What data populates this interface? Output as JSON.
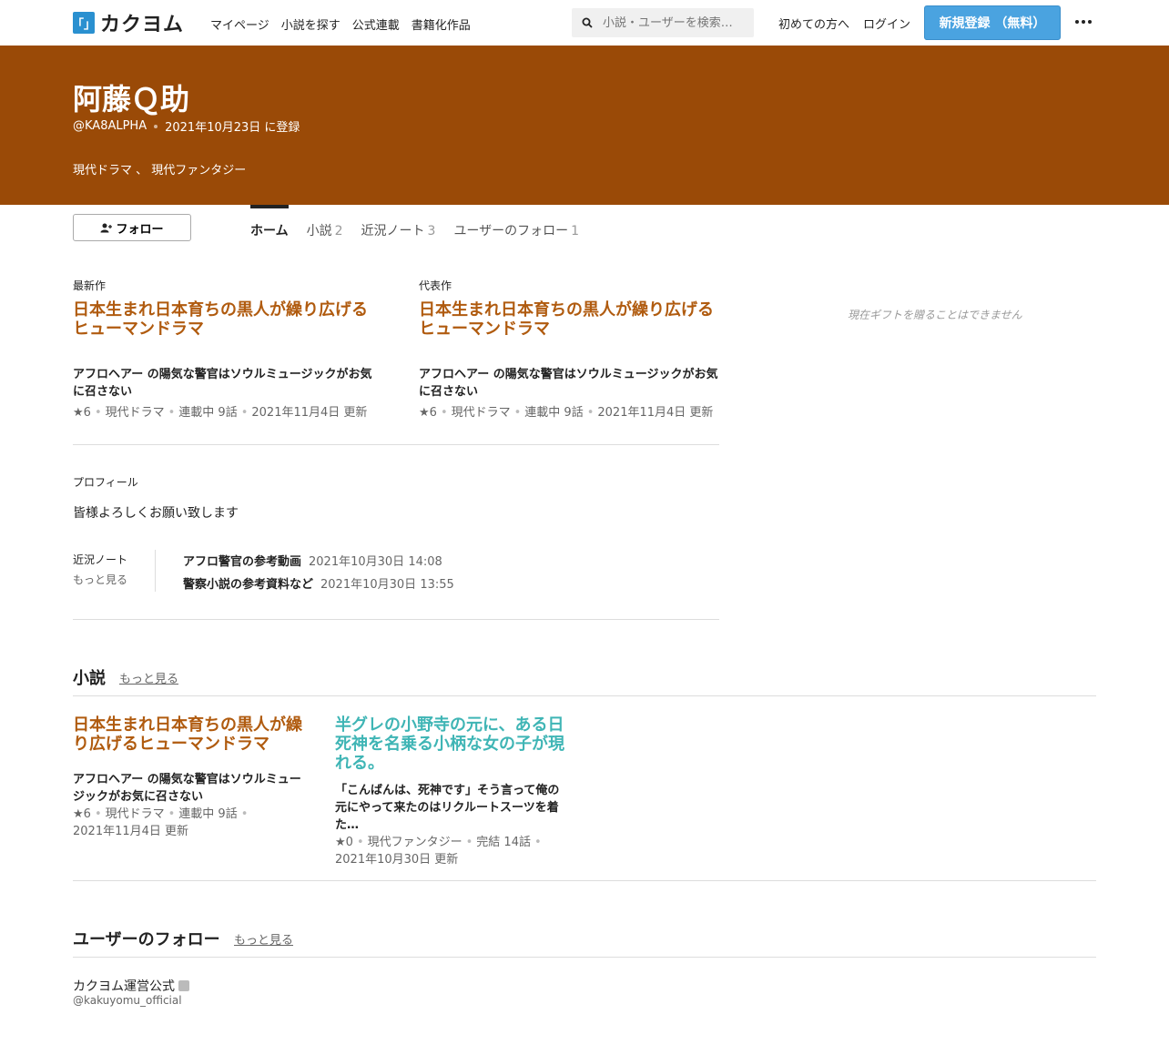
{
  "header": {
    "logo_mark": "「」",
    "logo_text": "カクヨム",
    "nav": [
      "マイページ",
      "小説を探す",
      "公式連載",
      "書籍化作品"
    ],
    "search_placeholder": "小説・ユーザーを検索…",
    "first_time": "初めての方へ",
    "login": "ログイン",
    "signup": "新規登録 （無料）"
  },
  "user": {
    "name": "阿藤Ｑ助",
    "handle": "@KA8ALPHA",
    "registered": "2021年10月23日 に登録",
    "genres": "現代ドラマ 、 現代ファンタジー"
  },
  "follow_label": "フォロー",
  "tabs": [
    {
      "label": "ホーム",
      "count": ""
    },
    {
      "label": "小説",
      "count": "2"
    },
    {
      "label": "近況ノート",
      "count": "3"
    },
    {
      "label": "ユーザーのフォロー",
      "count": "1"
    }
  ],
  "latest": {
    "label": "最新作",
    "title": "日本生まれ日本育ちの黒人が繰り広げるヒューマンドラマ",
    "catch": "アフロヘアー の陽気な警官はソウルミュージックがお気に召さない",
    "stars": "★6",
    "genre": "現代ドラマ",
    "status": "連載中 9話",
    "updated": "2021年11月4日 更新"
  },
  "featured": {
    "label": "代表作",
    "title": "日本生まれ日本育ちの黒人が繰り広げるヒューマンドラマ",
    "catch": "アフロヘアー の陽気な警官はソウルミュージックがお気に召さない",
    "stars": "★6",
    "genre": "現代ドラマ",
    "status": "連載中 9話",
    "updated": "2021年11月4日 更新"
  },
  "gift_text": "現在ギフトを贈ることはできません",
  "profile": {
    "label": "プロフィール",
    "text": "皆様よろしくお願い致します"
  },
  "notes": {
    "label": "近況ノート",
    "more": "もっと見る",
    "items": [
      {
        "title": "アフロ警官の参考動画",
        "date": "2021年10月30日 14:08"
      },
      {
        "title": "警察小説の参考資料など",
        "date": "2021年10月30日 13:55"
      }
    ]
  },
  "novels": {
    "title": "小説",
    "more": "もっと見る",
    "items": [
      {
        "title": "日本生まれ日本育ちの黒人が繰り広げるヒューマンドラマ",
        "catch": "アフロヘアー の陽気な警官はソウルミュージックがお気に召さない",
        "stars": "★6",
        "genre": "現代ドラマ",
        "status": "連載中 9話",
        "updated": "2021年11月4日 更新",
        "color": "#b05b0f"
      },
      {
        "title": "半グレの小野寺の元に、ある日死神を名乗る小柄な女の子が現れる。",
        "catch": "「こんばんは、死神です」そう言って俺の元にやって来たのはリクルートスーツを着た…",
        "stars": "★0",
        "genre": "現代ファンタジー",
        "status": "完結 14話",
        "updated": "2021年10月30日 更新",
        "color": "#3fb5b5"
      }
    ]
  },
  "follows": {
    "title": "ユーザーのフォロー",
    "more": "もっと見る",
    "user_name": "カクヨム運営公式",
    "user_handle": "@kakuyomu_official"
  },
  "colors": {
    "hero_bg": "#9a4a07",
    "accent_orange": "#b05b0f",
    "accent_teal": "#3fb5b5",
    "signup_blue": "#4aa3e0"
  }
}
